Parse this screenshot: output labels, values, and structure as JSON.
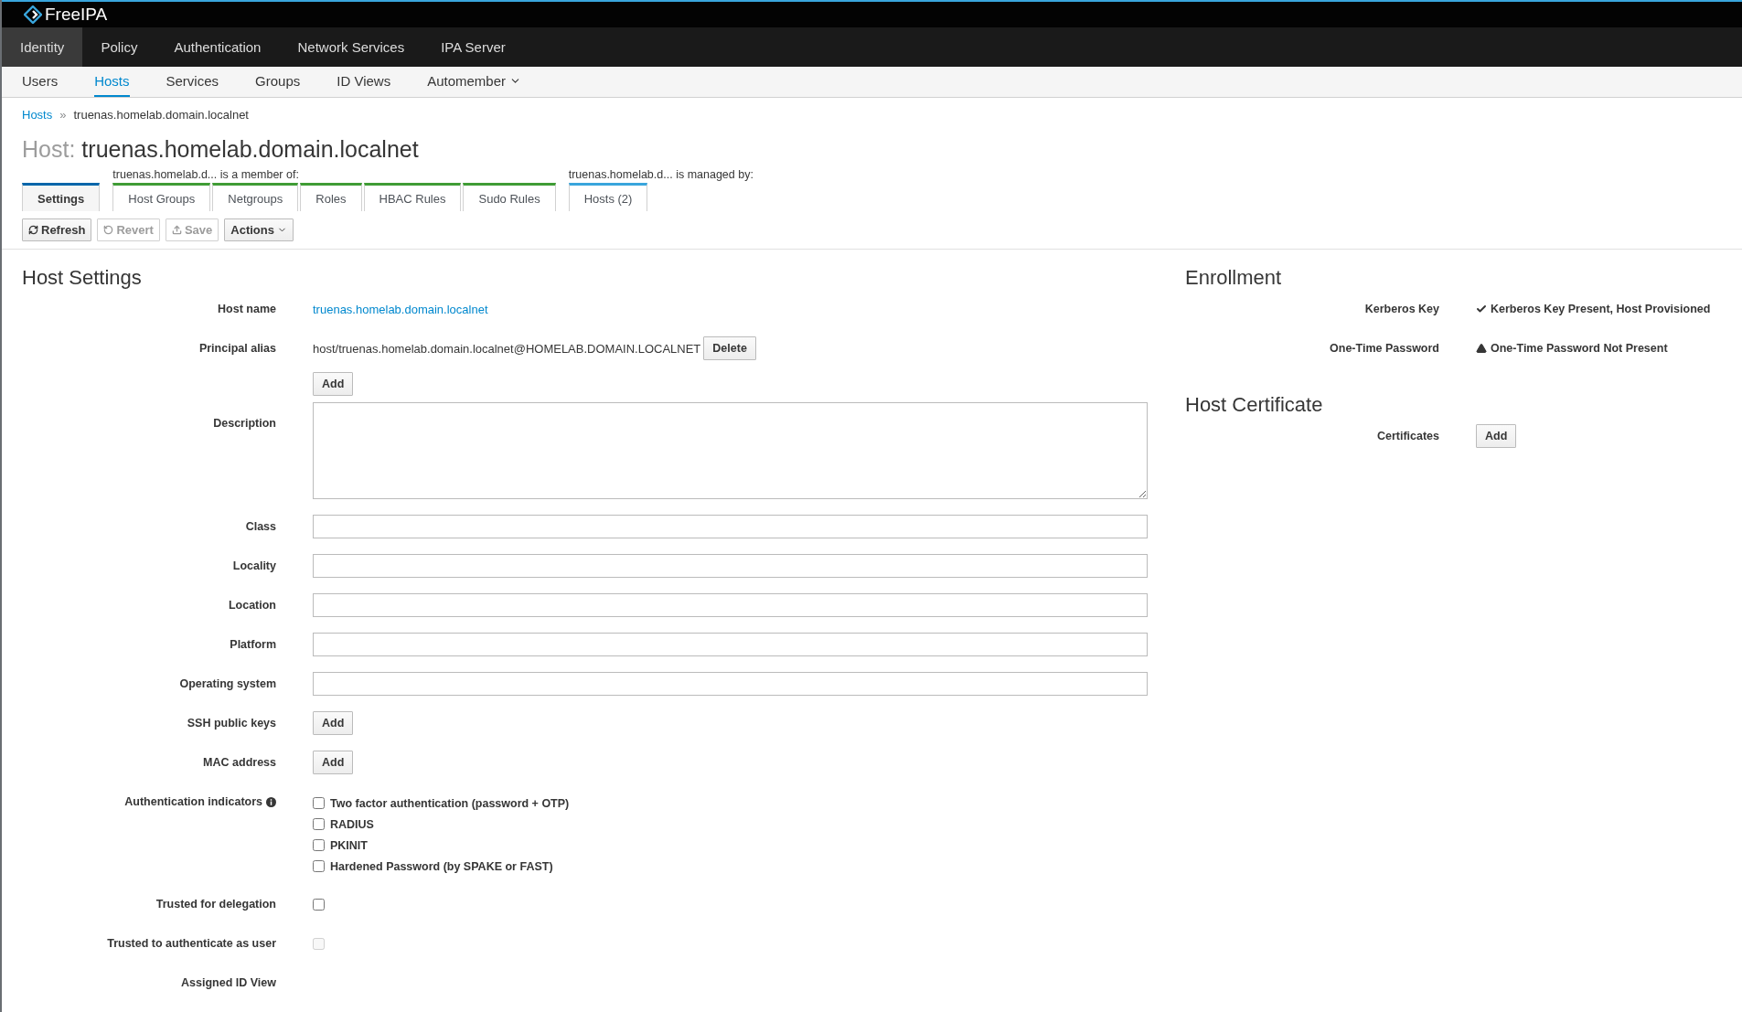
{
  "brand": "FreeIPA",
  "nav": [
    {
      "label": "Identity",
      "selected": true
    },
    {
      "label": "Policy",
      "selected": false
    },
    {
      "label": "Authentication",
      "selected": false
    },
    {
      "label": "Network Services",
      "selected": false
    },
    {
      "label": "IPA Server",
      "selected": false
    }
  ],
  "subnav": [
    {
      "label": "Users",
      "selected": false,
      "kind": "link"
    },
    {
      "label": "Hosts",
      "selected": true,
      "kind": "link"
    },
    {
      "label": "Services",
      "selected": false,
      "kind": "link"
    },
    {
      "label": "Groups",
      "selected": false,
      "kind": "link"
    },
    {
      "label": "ID Views",
      "selected": false,
      "kind": "link"
    },
    {
      "label": "Automember",
      "selected": false,
      "kind": "menu"
    }
  ],
  "breadcrumb": {
    "parent": "Hosts",
    "separator": "»",
    "current": "truenas.homelab.domain.localnet"
  },
  "title": {
    "prefix": "Host:",
    "name": "truenas.homelab.domain.localnet"
  },
  "tab_groups": [
    {
      "color": "#0066aa",
      "tabs": [
        {
          "label": "Settings",
          "selected": true
        }
      ]
    },
    {
      "caption": "truenas.homelab.d... is a member of:",
      "color": "#3f9c35",
      "tabs": [
        {
          "label": "Host Groups",
          "selected": false
        },
        {
          "label": "Netgroups",
          "selected": false
        },
        {
          "label": "Roles",
          "selected": false
        },
        {
          "label": "HBAC Rules",
          "selected": false
        },
        {
          "label": "Sudo Rules",
          "selected": false
        }
      ]
    },
    {
      "caption": "truenas.homelab.d... is managed by:",
      "color": "#39a5dc",
      "tabs": [
        {
          "label": "Hosts (2)",
          "selected": false
        }
      ]
    }
  ],
  "toolbar": [
    {
      "label": "Refresh",
      "kind": "refresh",
      "disabled": false
    },
    {
      "label": "Revert",
      "kind": "revert",
      "disabled": true
    },
    {
      "label": "Save",
      "kind": "save",
      "disabled": true
    },
    {
      "label": "Actions",
      "kind": "menu",
      "disabled": false
    }
  ],
  "host_settings": {
    "heading": "Host Settings",
    "fields": [
      {
        "label": "Host name",
        "kind": "link",
        "value": "truenas.homelab.domain.localnet"
      },
      {
        "label": "Principal alias",
        "kind": "multivalue",
        "values": [
          {
            "text": "host/truenas.homelab.domain.localnet@HOMELAB.DOMAIN.LOCALNET",
            "button": "Delete"
          }
        ],
        "add": "Add"
      },
      {
        "label": "Description",
        "kind": "textarea"
      },
      {
        "label": "Class",
        "kind": "input"
      },
      {
        "label": "Locality",
        "kind": "input"
      },
      {
        "label": "Location",
        "kind": "input"
      },
      {
        "label": "Platform",
        "kind": "input"
      },
      {
        "label": "Operating system",
        "kind": "input"
      },
      {
        "label": "SSH public keys",
        "kind": "add",
        "add": "Add"
      },
      {
        "label": "MAC address",
        "kind": "add",
        "add": "Add"
      },
      {
        "label": "Authentication indicators",
        "kind": "checkboxes",
        "info": true,
        "options": [
          {
            "label": "Two factor authentication (password + OTP)",
            "checked": false
          },
          {
            "label": "RADIUS",
            "checked": false
          },
          {
            "label": "PKINIT",
            "checked": false
          },
          {
            "label": "Hardened Password (by SPAKE or FAST)",
            "checked": false
          }
        ]
      },
      {
        "label": "Trusted for delegation",
        "kind": "checkbox",
        "checked": false,
        "disabled": false
      },
      {
        "label": "Trusted to authenticate as user",
        "kind": "checkbox",
        "checked": false,
        "disabled": true
      },
      {
        "label": "Assigned ID View",
        "kind": "empty"
      }
    ]
  },
  "enrollment": {
    "heading": "Enrollment",
    "rows": [
      {
        "label": "Kerberos Key",
        "kind": "ok",
        "value": "Kerberos Key Present, Host Provisioned"
      },
      {
        "label": "One-Time Password",
        "kind": "warning",
        "value": "One-Time Password Not Present"
      }
    ]
  },
  "host_certificate": {
    "heading": "Host Certificate",
    "rows": [
      {
        "label": "Certificates",
        "add": "Add"
      }
    ]
  }
}
